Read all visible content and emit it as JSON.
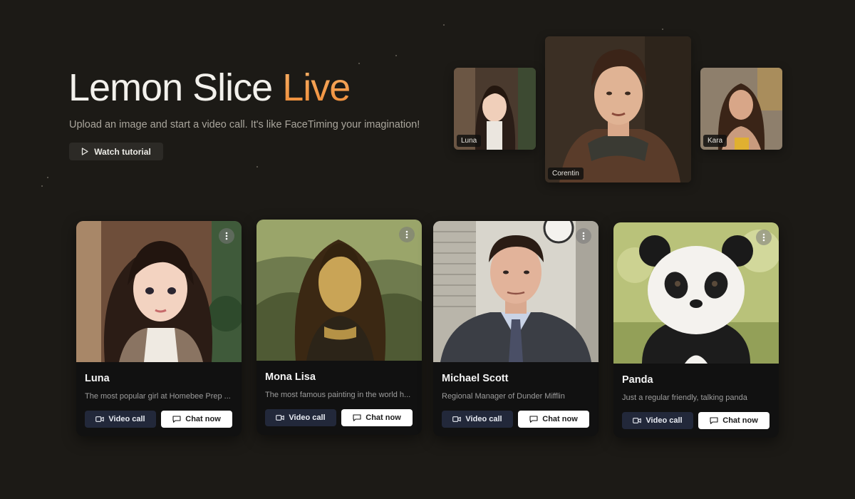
{
  "hero": {
    "title_main": "Lemon Slice",
    "title_accent": "Live",
    "subtitle": "Upload an image and start a video call. It's like FaceTiming your imagination!",
    "watch_button": "Watch tutorial"
  },
  "featured": [
    {
      "name": "Luna"
    },
    {
      "name": "Corentin"
    },
    {
      "name": "Kara"
    }
  ],
  "cards": [
    {
      "name": "Luna",
      "description": "The most popular girl at Homebee Prep ...",
      "video_label": "Video call",
      "chat_label": "Chat now"
    },
    {
      "name": "Mona Lisa",
      "description": "The most famous painting in the world h...",
      "video_label": "Video call",
      "chat_label": "Chat now"
    },
    {
      "name": "Michael Scott",
      "description": "Regional Manager of Dunder Mifflin",
      "video_label": "Video call",
      "chat_label": "Chat now"
    },
    {
      "name": "Panda",
      "description": "Just a regular friendly, talking panda",
      "video_label": "Video call",
      "chat_label": "Chat now"
    }
  ],
  "colors": {
    "background": "#1c1a16",
    "accent": "#ee8a35",
    "video_button": "#22283a",
    "chat_button": "#ffffff"
  },
  "icons": {
    "watch": "play-icon",
    "menu": "more-vertical-icon",
    "video": "video-camera-icon",
    "chat": "chat-bubble-icon"
  }
}
